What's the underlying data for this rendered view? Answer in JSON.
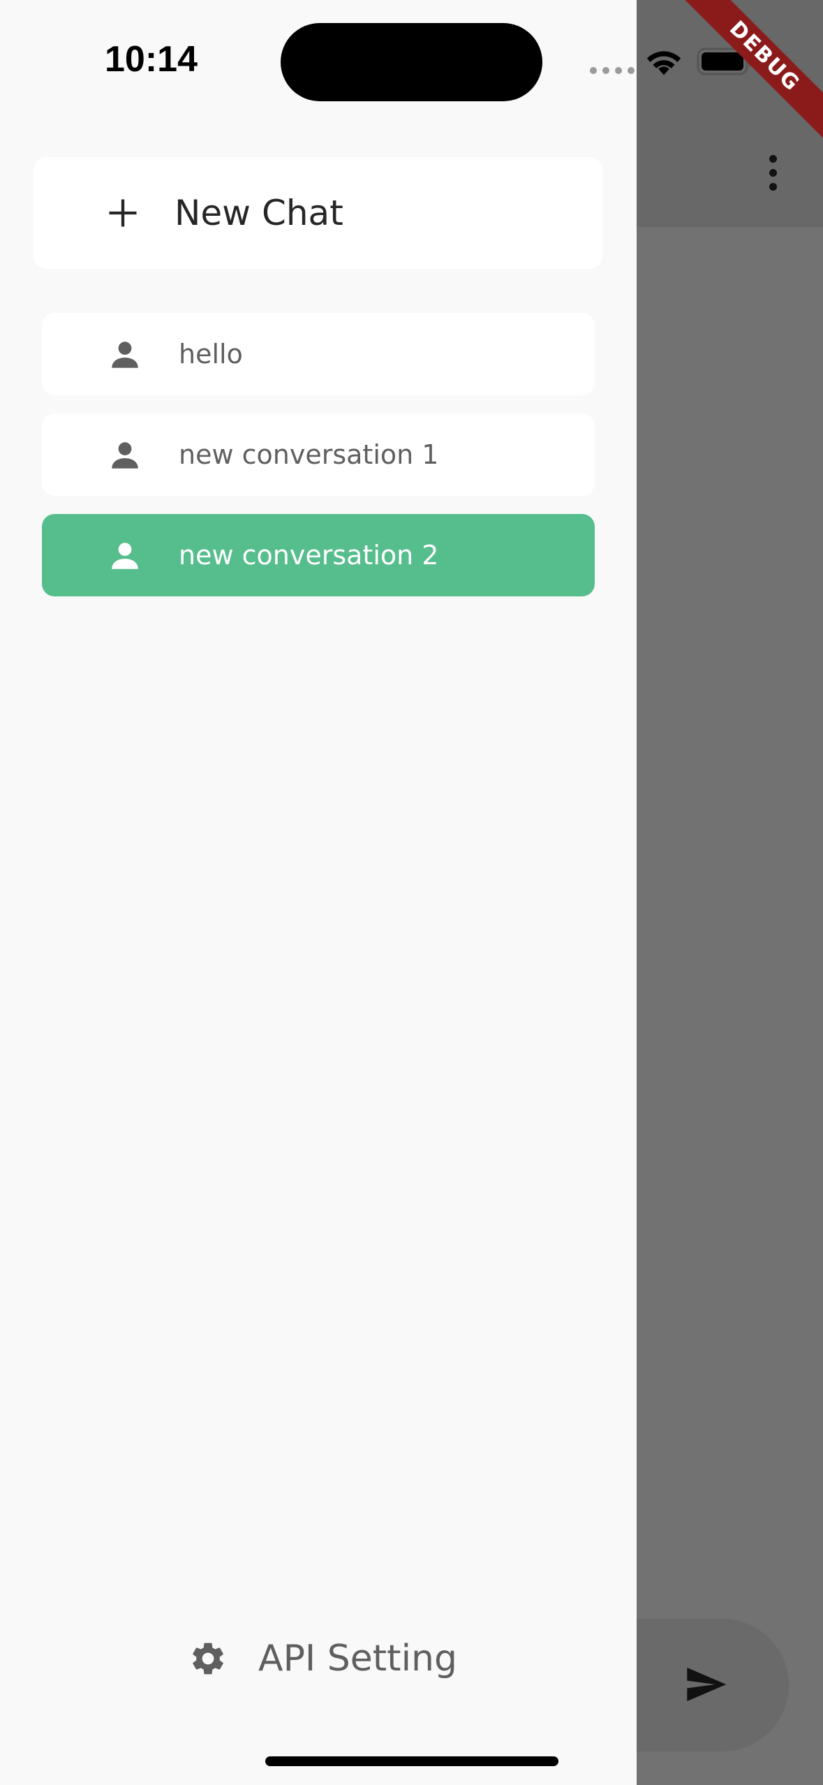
{
  "status_bar": {
    "time": "10:14"
  },
  "debug_banner": {
    "label": "DEBUG"
  },
  "drawer": {
    "new_chat_label": "New Chat",
    "conversations": [
      {
        "label": "hello",
        "active": false
      },
      {
        "label": "new conversation 1",
        "active": false
      },
      {
        "label": "new conversation 2",
        "active": true
      }
    ],
    "api_setting_label": "API Setting"
  },
  "colors": {
    "accent": "#56bd8d",
    "drawer_bg": "#f9f9f9",
    "scrim": "#727272",
    "debug_banner": "#8b1a1a"
  },
  "icons": {
    "new_chat": "plus-icon",
    "conversation": "person-icon",
    "settings": "gear-icon",
    "more": "more-vert-icon",
    "send": "send-icon"
  }
}
